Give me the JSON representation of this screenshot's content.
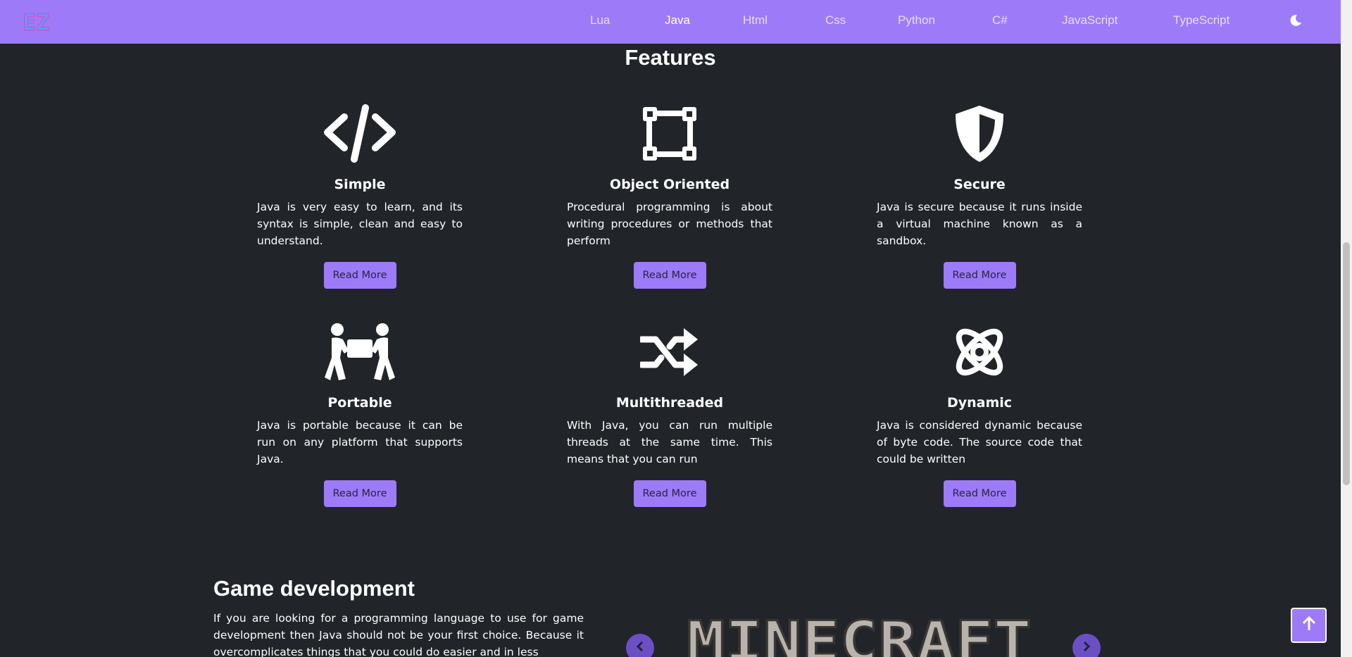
{
  "navbar": {
    "logo_text": "EZ",
    "items": [
      {
        "label": "Lua",
        "active": false
      },
      {
        "label": "Java",
        "active": true
      },
      {
        "label": "Html",
        "active": false
      },
      {
        "label": "Css",
        "active": false
      },
      {
        "label": "Python",
        "active": false
      },
      {
        "label": "C#",
        "active": false
      },
      {
        "label": "JavaScript",
        "active": false
      },
      {
        "label": "TypeScript",
        "active": false
      }
    ],
    "theme_icon": "moon-icon"
  },
  "features": {
    "title": "Features",
    "button_label": "Read More",
    "items": [
      {
        "icon": "code-icon",
        "title": "Simple",
        "text": "Java is very easy to learn, and its syntax is simple, clean and easy to understand."
      },
      {
        "icon": "vector-square-icon",
        "title": "Object Oriented",
        "text": "Procedural programming is about writing procedures or methods that perform"
      },
      {
        "icon": "shield-icon",
        "title": "Secure",
        "text": "Java is secure because it runs inside a virtual machine known as a sandbox."
      },
      {
        "icon": "people-carry-icon",
        "title": "Portable",
        "text": "Java is portable because it can be run on any platform that supports Java."
      },
      {
        "icon": "shuffle-icon",
        "title": "Multithreaded",
        "text": "With Java, you can run multiple threads at the same time. This means that you can run"
      },
      {
        "icon": "atom-icon",
        "title": "Dynamic",
        "text": "Java is considered dynamic because of byte code. The source code that could be written"
      }
    ]
  },
  "game": {
    "title": "Game development",
    "text": "If you are looking for a programming language to use for game development then Java should not be your first choice. Because it overcomplicates things that you could do easier and in less",
    "carousel_image_text": "MINECRAFT"
  },
  "colors": {
    "accent": "#9d7bf8",
    "background": "#212529"
  }
}
